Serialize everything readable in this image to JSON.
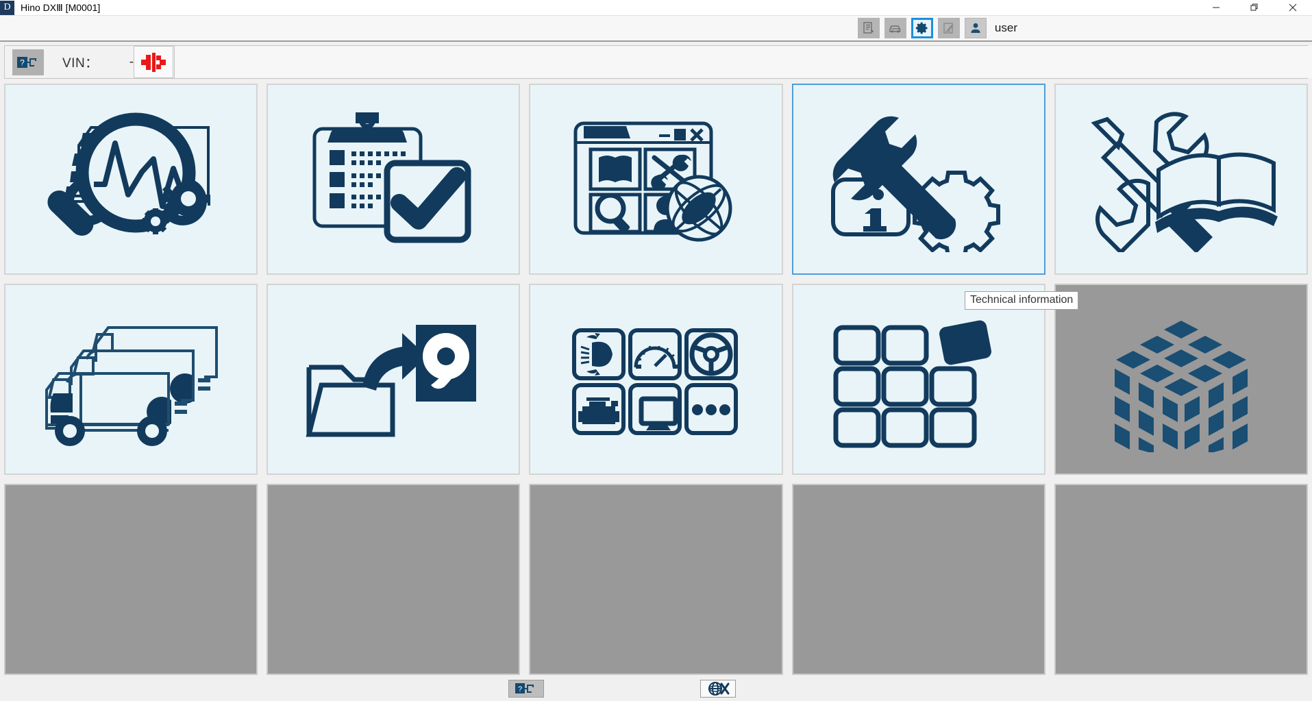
{
  "window": {
    "app_icon": "app-d-icon",
    "title": "Hino DXⅢ [M0001]",
    "minimize_label": "—",
    "restore_label": "❐",
    "close_label": "✕"
  },
  "toolbar": {
    "buttons": [
      {
        "name": "vehicle-report-icon",
        "state": "normal"
      },
      {
        "name": "vehicle-icon",
        "state": "normal"
      },
      {
        "name": "gear-icon",
        "state": "active"
      },
      {
        "name": "edit-note-icon",
        "state": "normal"
      },
      {
        "name": "user-icon",
        "state": "normal"
      }
    ],
    "user_label": "user"
  },
  "vinbar": {
    "connector_icon": "connector-status-icon",
    "vin_label": "VIN：",
    "vin_value": "-",
    "red_connector_icon": "red-connector-icon"
  },
  "tiles": [
    {
      "id": "diagnostics",
      "icon": "truck-magnifier-gears-icon",
      "state": "enabled"
    },
    {
      "id": "inspection",
      "icon": "clipboard-check-icon",
      "state": "enabled"
    },
    {
      "id": "online-portal",
      "icon": "browser-globe-icon",
      "state": "enabled"
    },
    {
      "id": "technical-info",
      "icon": "info-wrench-gear-icon",
      "state": "selected"
    },
    {
      "id": "service-manual",
      "icon": "tools-book-icon",
      "state": "enabled"
    },
    {
      "id": "vehicle-select",
      "icon": "three-trucks-icon",
      "state": "enabled"
    },
    {
      "id": "data-backup",
      "icon": "folder-arrow-harddisk-icon",
      "state": "enabled"
    },
    {
      "id": "functions",
      "icon": "six-function-grid-icon",
      "state": "enabled"
    },
    {
      "id": "customize-layout",
      "icon": "tile-arrange-icon",
      "state": "enabled"
    },
    {
      "id": "module-cube",
      "icon": "iso-cube-icon",
      "state": "disabled"
    },
    {
      "id": "empty-1",
      "icon": "",
      "state": "empty"
    },
    {
      "id": "empty-2",
      "icon": "",
      "state": "empty"
    },
    {
      "id": "empty-3",
      "icon": "",
      "state": "empty"
    },
    {
      "id": "empty-4",
      "icon": "",
      "state": "empty"
    },
    {
      "id": "empty-5",
      "icon": "",
      "state": "empty"
    }
  ],
  "tooltip": {
    "text": "Technical information"
  },
  "statusbar": {
    "left_button_icon": "connector-status-icon",
    "right_button_icon": "globe-disconnected-icon"
  },
  "colors": {
    "navy": "#123A5C",
    "tile_bg": "#e8f4f8",
    "tile_border": "#d4d4d4",
    "selected_border": "#4a9fd8",
    "disabled_bg": "#999999",
    "accent_blue": "#1a8fe0",
    "red": "#e8191b"
  }
}
